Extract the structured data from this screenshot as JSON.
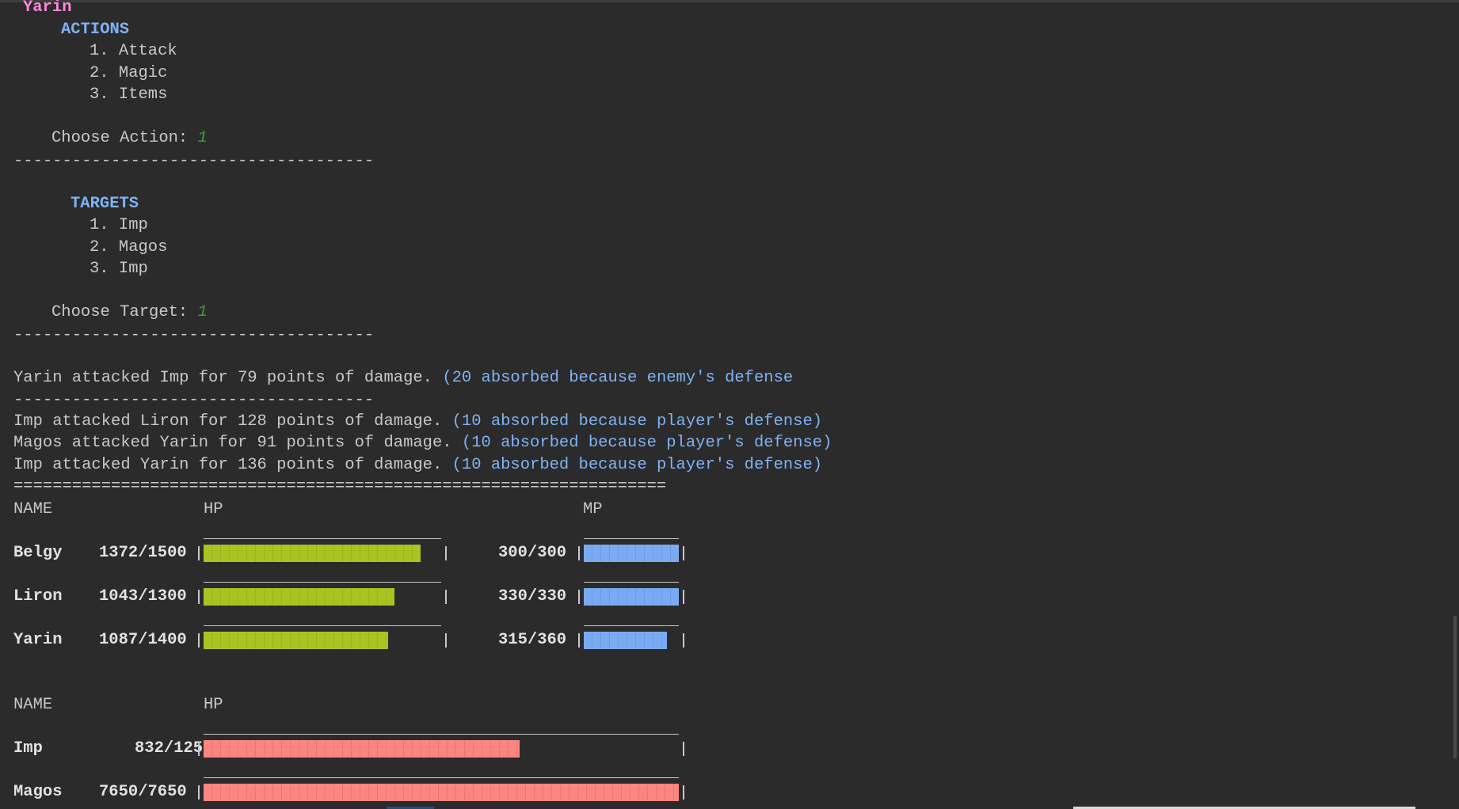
{
  "player_name": "Yarin",
  "actions": {
    "heading": "ACTIONS",
    "items": [
      "1. Attack",
      "2. Magic",
      "3. Items"
    ],
    "prompt": "Choose Action:",
    "choice": "1"
  },
  "targets": {
    "heading": "TARGETS",
    "items": [
      "1. Imp",
      "2. Magos",
      "3. Imp"
    ],
    "prompt": "Choose Target:",
    "choice": "1"
  },
  "separator": "-------------------------------------",
  "double_separator": "===================================================================",
  "log": [
    {
      "text": "Yarin attacked Imp for 79 points of damage.",
      "note": "(20 absorbed because enemy's defense"
    },
    {
      "text": "Imp attacked Liron for 128 points of damage.",
      "note": "(10 absorbed because player's defense)"
    },
    {
      "text": "Magos attacked Yarin for 91 points of damage.",
      "note": "(10 absorbed because player's defense)"
    },
    {
      "text": "Imp attacked Yarin for 136 points of damage.",
      "note": "(10 absorbed because player's defense)"
    }
  ],
  "party_table": {
    "headers": {
      "name": "NAME",
      "hp": "HP",
      "mp": "MP"
    },
    "rows": [
      {
        "name": "Belgy",
        "hp_text": "1372/1500",
        "hp": 1372,
        "hp_max": 1500,
        "mp_text": "300/300",
        "mp": 300,
        "mp_max": 300
      },
      {
        "name": "Liron",
        "hp_text": "1043/1300",
        "hp": 1043,
        "hp_max": 1300,
        "mp_text": "330/330",
        "mp": 330,
        "mp_max": 330
      },
      {
        "name": "Yarin",
        "hp_text": "1087/1400",
        "hp": 1087,
        "hp_max": 1400,
        "mp_text": "315/360",
        "mp": 315,
        "mp_max": 360
      }
    ]
  },
  "enemy_table": {
    "headers": {
      "name": "NAME",
      "hp": "HP"
    },
    "rows": [
      {
        "name": "Imp",
        "hp_text": "832/1250",
        "hp": 832,
        "hp_max": 1250
      },
      {
        "name": "Magos",
        "hp_text": "7650/7650",
        "hp": 7650,
        "hp_max": 7650
      }
    ]
  },
  "colors": {
    "hp": "#a9c422",
    "mp": "#7aabf2",
    "enemy_hp": "#fb8580"
  }
}
